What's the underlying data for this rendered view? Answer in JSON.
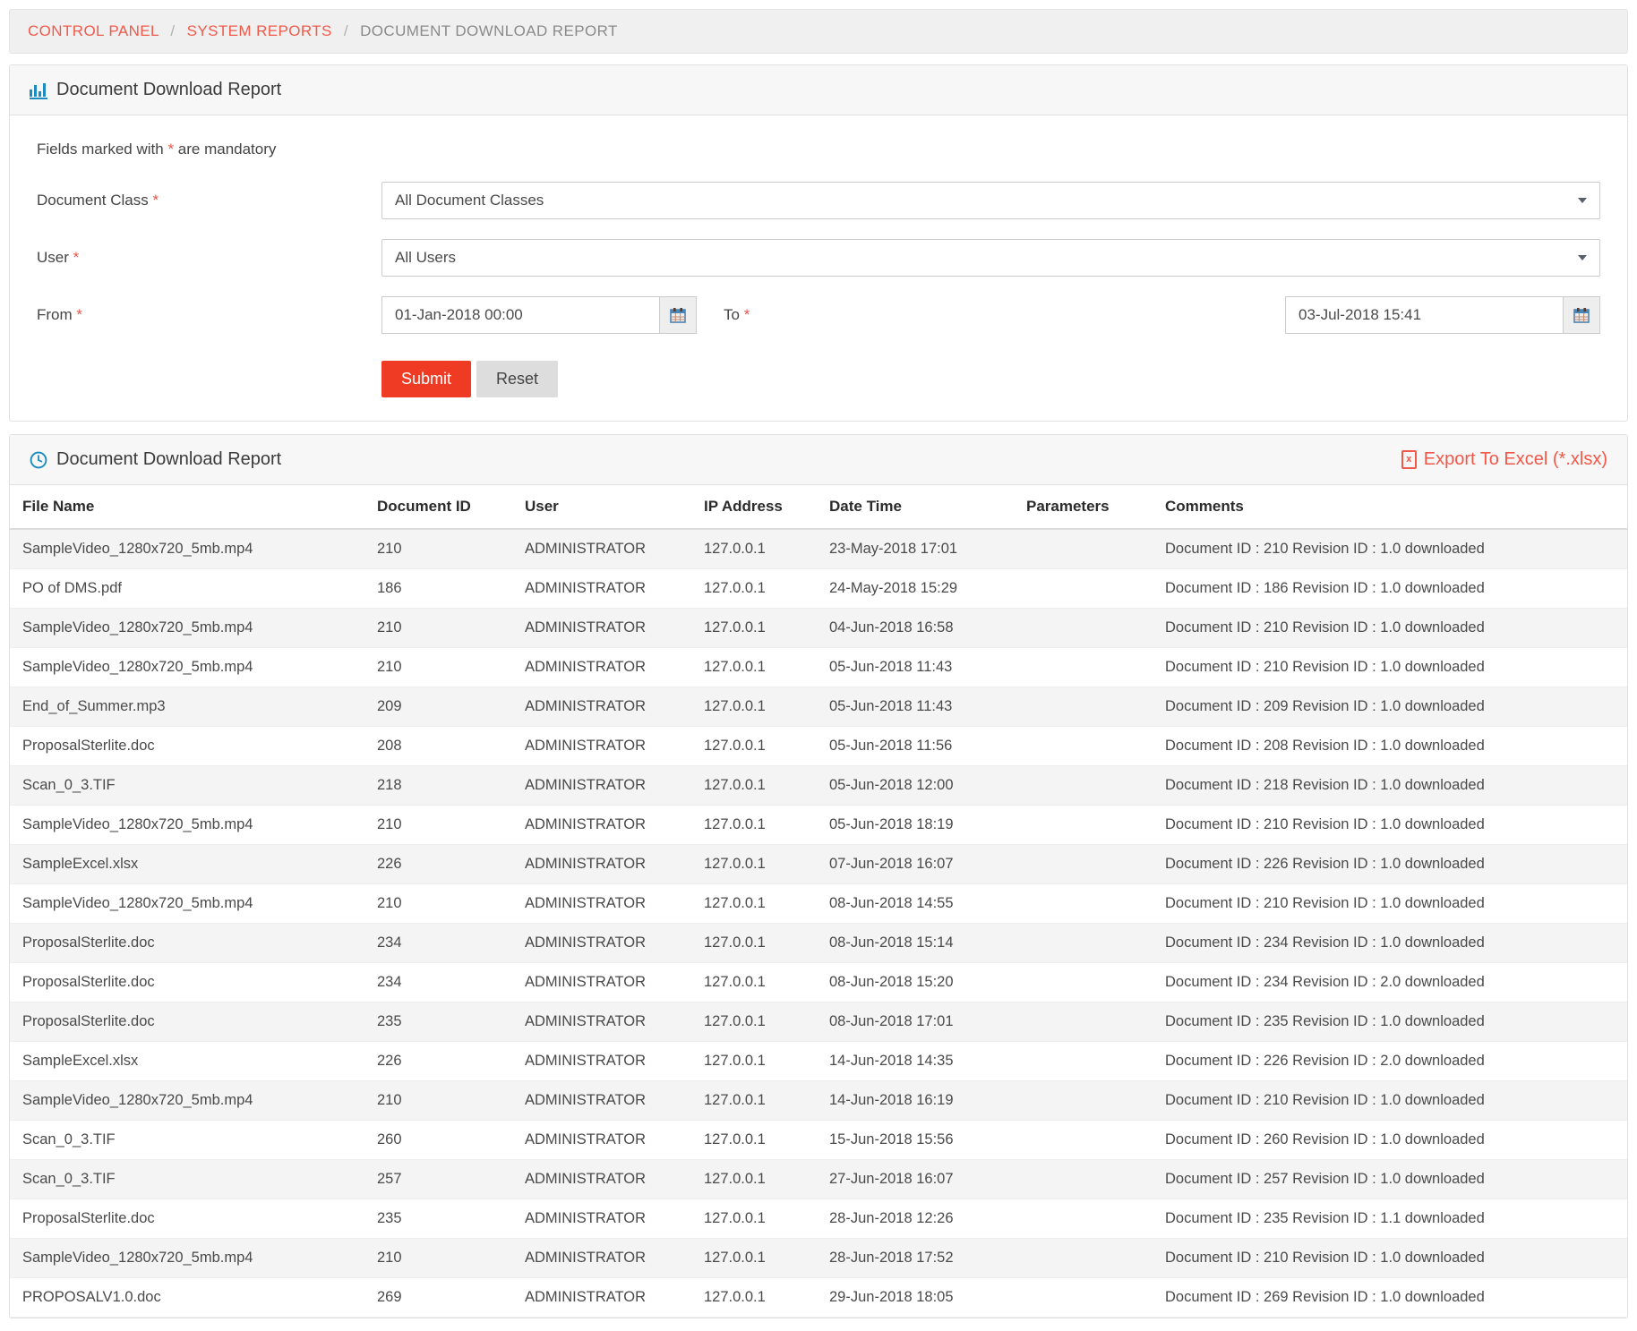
{
  "breadcrumb": {
    "items": [
      {
        "label": "CONTROL PANEL",
        "type": "link"
      },
      {
        "label": "SYSTEM REPORTS",
        "type": "link"
      },
      {
        "label": "DOCUMENT DOWNLOAD REPORT",
        "type": "current"
      }
    ],
    "separator": "/"
  },
  "filter_panel": {
    "icon": "bar-chart-icon",
    "title": "Document Download Report",
    "mandatory_note_before": "Fields marked with ",
    "mandatory_note_star": "*",
    "mandatory_note_after": " are mandatory",
    "fields": {
      "document_class": {
        "label": "Document Class",
        "required_mark": "*",
        "value": "All Document Classes"
      },
      "user": {
        "label": "User",
        "required_mark": "*",
        "value": "All Users"
      },
      "from": {
        "label": "From",
        "required_mark": "*",
        "value": "01-Jan-2018 00:00",
        "icon": "calendar-icon"
      },
      "to": {
        "label": "To",
        "required_mark": "*",
        "value": "03-Jul-2018 15:41",
        "icon": "calendar-icon"
      }
    },
    "submit_label": "Submit",
    "reset_label": "Reset"
  },
  "report_panel": {
    "icon": "clock-icon",
    "title": "Document Download Report",
    "export_label": "Export To Excel (*.xlsx)",
    "export_icon": "excel-file-icon",
    "columns": [
      "File Name",
      "Document ID",
      "User",
      "IP Address",
      "Date Time",
      "Parameters",
      "Comments"
    ],
    "rows": [
      [
        "SampleVideo_1280x720_5mb.mp4",
        "210",
        "ADMINISTRATOR",
        "127.0.0.1",
        "23-May-2018 17:01",
        "",
        "Document ID : 210 Revision ID : 1.0 downloaded"
      ],
      [
        "PO of DMS.pdf",
        "186",
        "ADMINISTRATOR",
        "127.0.0.1",
        "24-May-2018 15:29",
        "",
        "Document ID : 186 Revision ID : 1.0 downloaded"
      ],
      [
        "SampleVideo_1280x720_5mb.mp4",
        "210",
        "ADMINISTRATOR",
        "127.0.0.1",
        "04-Jun-2018 16:58",
        "",
        "Document ID : 210 Revision ID : 1.0 downloaded"
      ],
      [
        "SampleVideo_1280x720_5mb.mp4",
        "210",
        "ADMINISTRATOR",
        "127.0.0.1",
        "05-Jun-2018 11:43",
        "",
        "Document ID : 210 Revision ID : 1.0 downloaded"
      ],
      [
        "End_of_Summer.mp3",
        "209",
        "ADMINISTRATOR",
        "127.0.0.1",
        "05-Jun-2018 11:43",
        "",
        "Document ID : 209 Revision ID : 1.0 downloaded"
      ],
      [
        "ProposalSterlite.doc",
        "208",
        "ADMINISTRATOR",
        "127.0.0.1",
        "05-Jun-2018 11:56",
        "",
        "Document ID : 208 Revision ID : 1.0 downloaded"
      ],
      [
        "Scan_0_3.TIF",
        "218",
        "ADMINISTRATOR",
        "127.0.0.1",
        "05-Jun-2018 12:00",
        "",
        "Document ID : 218 Revision ID : 1.0 downloaded"
      ],
      [
        "SampleVideo_1280x720_5mb.mp4",
        "210",
        "ADMINISTRATOR",
        "127.0.0.1",
        "05-Jun-2018 18:19",
        "",
        "Document ID : 210 Revision ID : 1.0 downloaded"
      ],
      [
        "SampleExcel.xlsx",
        "226",
        "ADMINISTRATOR",
        "127.0.0.1",
        "07-Jun-2018 16:07",
        "",
        "Document ID : 226 Revision ID : 1.0 downloaded"
      ],
      [
        "SampleVideo_1280x720_5mb.mp4",
        "210",
        "ADMINISTRATOR",
        "127.0.0.1",
        "08-Jun-2018 14:55",
        "",
        "Document ID : 210 Revision ID : 1.0 downloaded"
      ],
      [
        "ProposalSterlite.doc",
        "234",
        "ADMINISTRATOR",
        "127.0.0.1",
        "08-Jun-2018 15:14",
        "",
        "Document ID : 234 Revision ID : 1.0 downloaded"
      ],
      [
        "ProposalSterlite.doc",
        "234",
        "ADMINISTRATOR",
        "127.0.0.1",
        "08-Jun-2018 15:20",
        "",
        "Document ID : 234 Revision ID : 2.0 downloaded"
      ],
      [
        "ProposalSterlite.doc",
        "235",
        "ADMINISTRATOR",
        "127.0.0.1",
        "08-Jun-2018 17:01",
        "",
        "Document ID : 235 Revision ID : 1.0 downloaded"
      ],
      [
        "SampleExcel.xlsx",
        "226",
        "ADMINISTRATOR",
        "127.0.0.1",
        "14-Jun-2018 14:35",
        "",
        "Document ID : 226 Revision ID : 2.0 downloaded"
      ],
      [
        "SampleVideo_1280x720_5mb.mp4",
        "210",
        "ADMINISTRATOR",
        "127.0.0.1",
        "14-Jun-2018 16:19",
        "",
        "Document ID : 210 Revision ID : 1.0 downloaded"
      ],
      [
        "Scan_0_3.TIF",
        "260",
        "ADMINISTRATOR",
        "127.0.0.1",
        "15-Jun-2018 15:56",
        "",
        "Document ID : 260 Revision ID : 1.0 downloaded"
      ],
      [
        "Scan_0_3.TIF",
        "257",
        "ADMINISTRATOR",
        "127.0.0.1",
        "27-Jun-2018 16:07",
        "",
        "Document ID : 257 Revision ID : 1.0 downloaded"
      ],
      [
        "ProposalSterlite.doc",
        "235",
        "ADMINISTRATOR",
        "127.0.0.1",
        "28-Jun-2018 12:26",
        "",
        "Document ID : 235 Revision ID : 1.1 downloaded"
      ],
      [
        "SampleVideo_1280x720_5mb.mp4",
        "210",
        "ADMINISTRATOR",
        "127.0.0.1",
        "28-Jun-2018 17:52",
        "",
        "Document ID : 210 Revision ID : 1.0 downloaded"
      ],
      [
        "PROPOSALV1.0.doc",
        "269",
        "ADMINISTRATOR",
        "127.0.0.1",
        "29-Jun-2018 18:05",
        "",
        "Document ID : 269 Revision ID : 1.0 downloaded"
      ]
    ]
  },
  "colors": {
    "accent_red": "#ef3b24",
    "link_red": "#f05a4b",
    "icon_blue": "#1c8cc0"
  }
}
